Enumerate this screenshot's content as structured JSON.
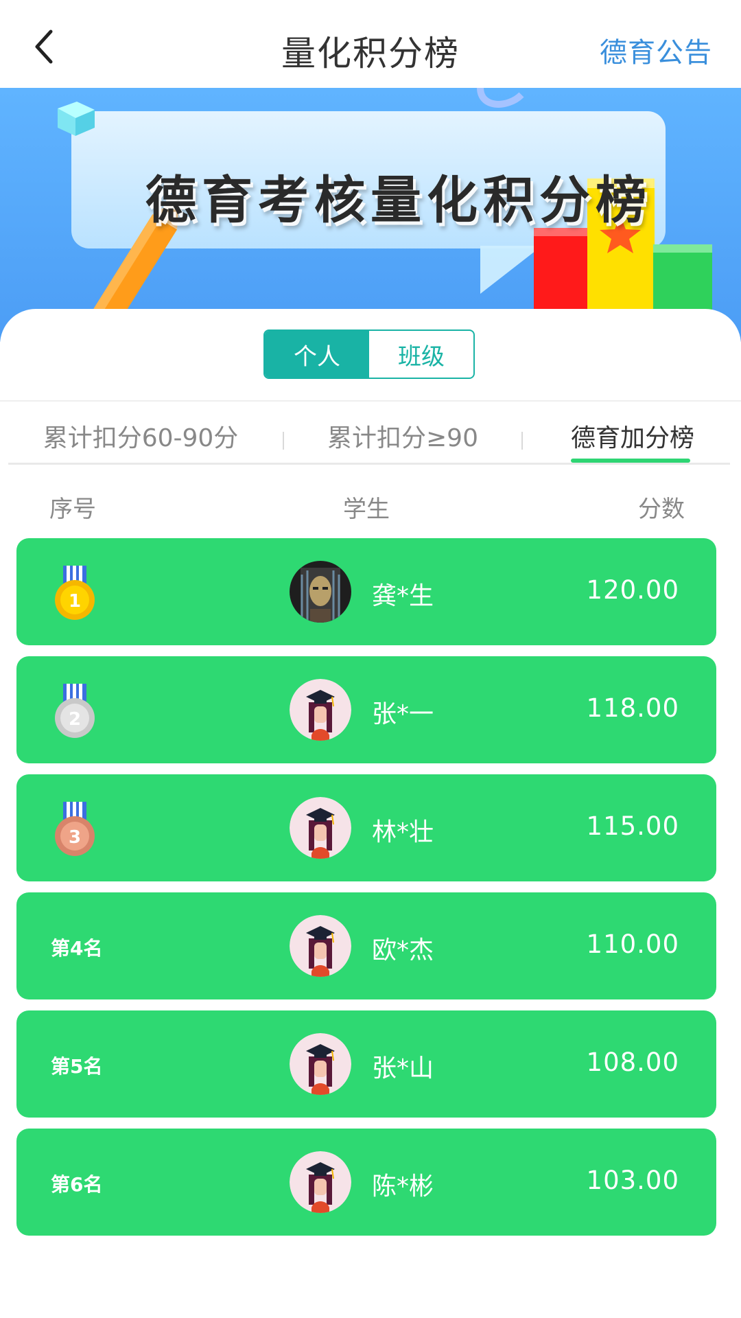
{
  "header": {
    "title": "量化积分榜",
    "link": "德育公告"
  },
  "banner": {
    "title": "德育考核量化积分榜"
  },
  "segment": {
    "items": [
      "个人",
      "班级"
    ],
    "active": "个人"
  },
  "tabs": {
    "items": [
      "累计扣分60-90分",
      "累计扣分≥90",
      "德育加分榜"
    ],
    "active": "德育加分榜"
  },
  "columns": {
    "rank": "序号",
    "student": "学生",
    "score": "分数"
  },
  "colors": {
    "accent_teal": "#19b3a5",
    "row_green": "#2ed972",
    "header_link_blue": "#3a8fdc"
  },
  "rows": [
    {
      "rank_label": "",
      "medal": "gold-medal-icon",
      "medal_number": "1",
      "name": "龚*生",
      "score": "120.00",
      "avatar": "masked-person-avatar"
    },
    {
      "rank_label": "",
      "medal": "silver-medal-icon",
      "medal_number": "2",
      "name": "张*一",
      "score": "118.00",
      "avatar": "graduate-avatar"
    },
    {
      "rank_label": "",
      "medal": "bronze-medal-icon",
      "medal_number": "3",
      "name": "林*壮",
      "score": "115.00",
      "avatar": "graduate-avatar"
    },
    {
      "rank_label": "第4名",
      "name": "欧*杰",
      "score": "110.00",
      "avatar": "graduate-avatar"
    },
    {
      "rank_label": "第5名",
      "name": "张*山",
      "score": "108.00",
      "avatar": "graduate-avatar"
    },
    {
      "rank_label": "第6名",
      "name": "陈*彬",
      "score": "103.00",
      "avatar": "graduate-avatar"
    }
  ]
}
